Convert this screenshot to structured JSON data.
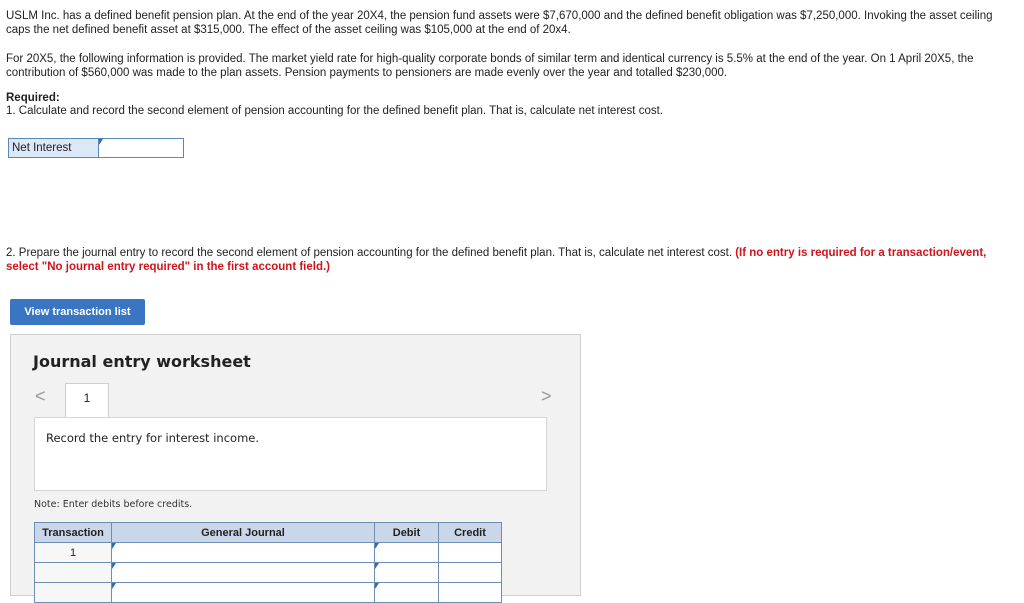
{
  "problem": {
    "para1": "USLM Inc. has a defined benefit pension plan. At the end of the year 20X4, the pension fund assets were $7,670,000 and the defined benefit obligation was $7,250,000. Invoking the asset ceiling caps the net defined benefit asset at $315,000. The effect of the asset ceiling was $105,000 at the end of 20x4.",
    "para2": "For 20X5, the following information is provided. The market yield rate for high-quality corporate bonds of similar term and identical currency is 5.5% at the end of the year. On 1 April 20X5, the contribution of $560,000 was made to the plan assets. Pension payments to pensioners are made evenly over the year and totalled $230,000."
  },
  "required": {
    "heading": "Required:",
    "q1": "1. Calculate and record the second element of pension accounting for the defined benefit plan. That is, calculate net interest cost.",
    "net_interest_label": "Net Interest",
    "net_interest_value": "",
    "q2_text": "2. Prepare the journal entry to record the second element of pension accounting for the defined benefit plan. That is, calculate net interest cost. ",
    "q2_instruction": "(If no entry is required for a transaction/event, select \"No journal entry required\" in the first account field.)"
  },
  "view_button": "View transaction list",
  "worksheet": {
    "title": "Journal entry worksheet",
    "prev_arrow": "<",
    "next_arrow": ">",
    "tab_number": "1",
    "entry_text": "Record the entry for interest income.",
    "note": "Note: Enter debits before credits.",
    "columns": [
      "Transaction",
      "General Journal",
      "Debit",
      "Credit"
    ],
    "rows": [
      {
        "transaction": "1",
        "account": "",
        "debit": "",
        "credit": ""
      },
      {
        "transaction": "",
        "account": "",
        "debit": "",
        "credit": ""
      },
      {
        "transaction": "",
        "account": "",
        "debit": "",
        "credit": ""
      }
    ]
  },
  "colors": {
    "accent": "#3a75c4",
    "alert": "#d0141c",
    "header_bg": "#c9d7e8"
  }
}
